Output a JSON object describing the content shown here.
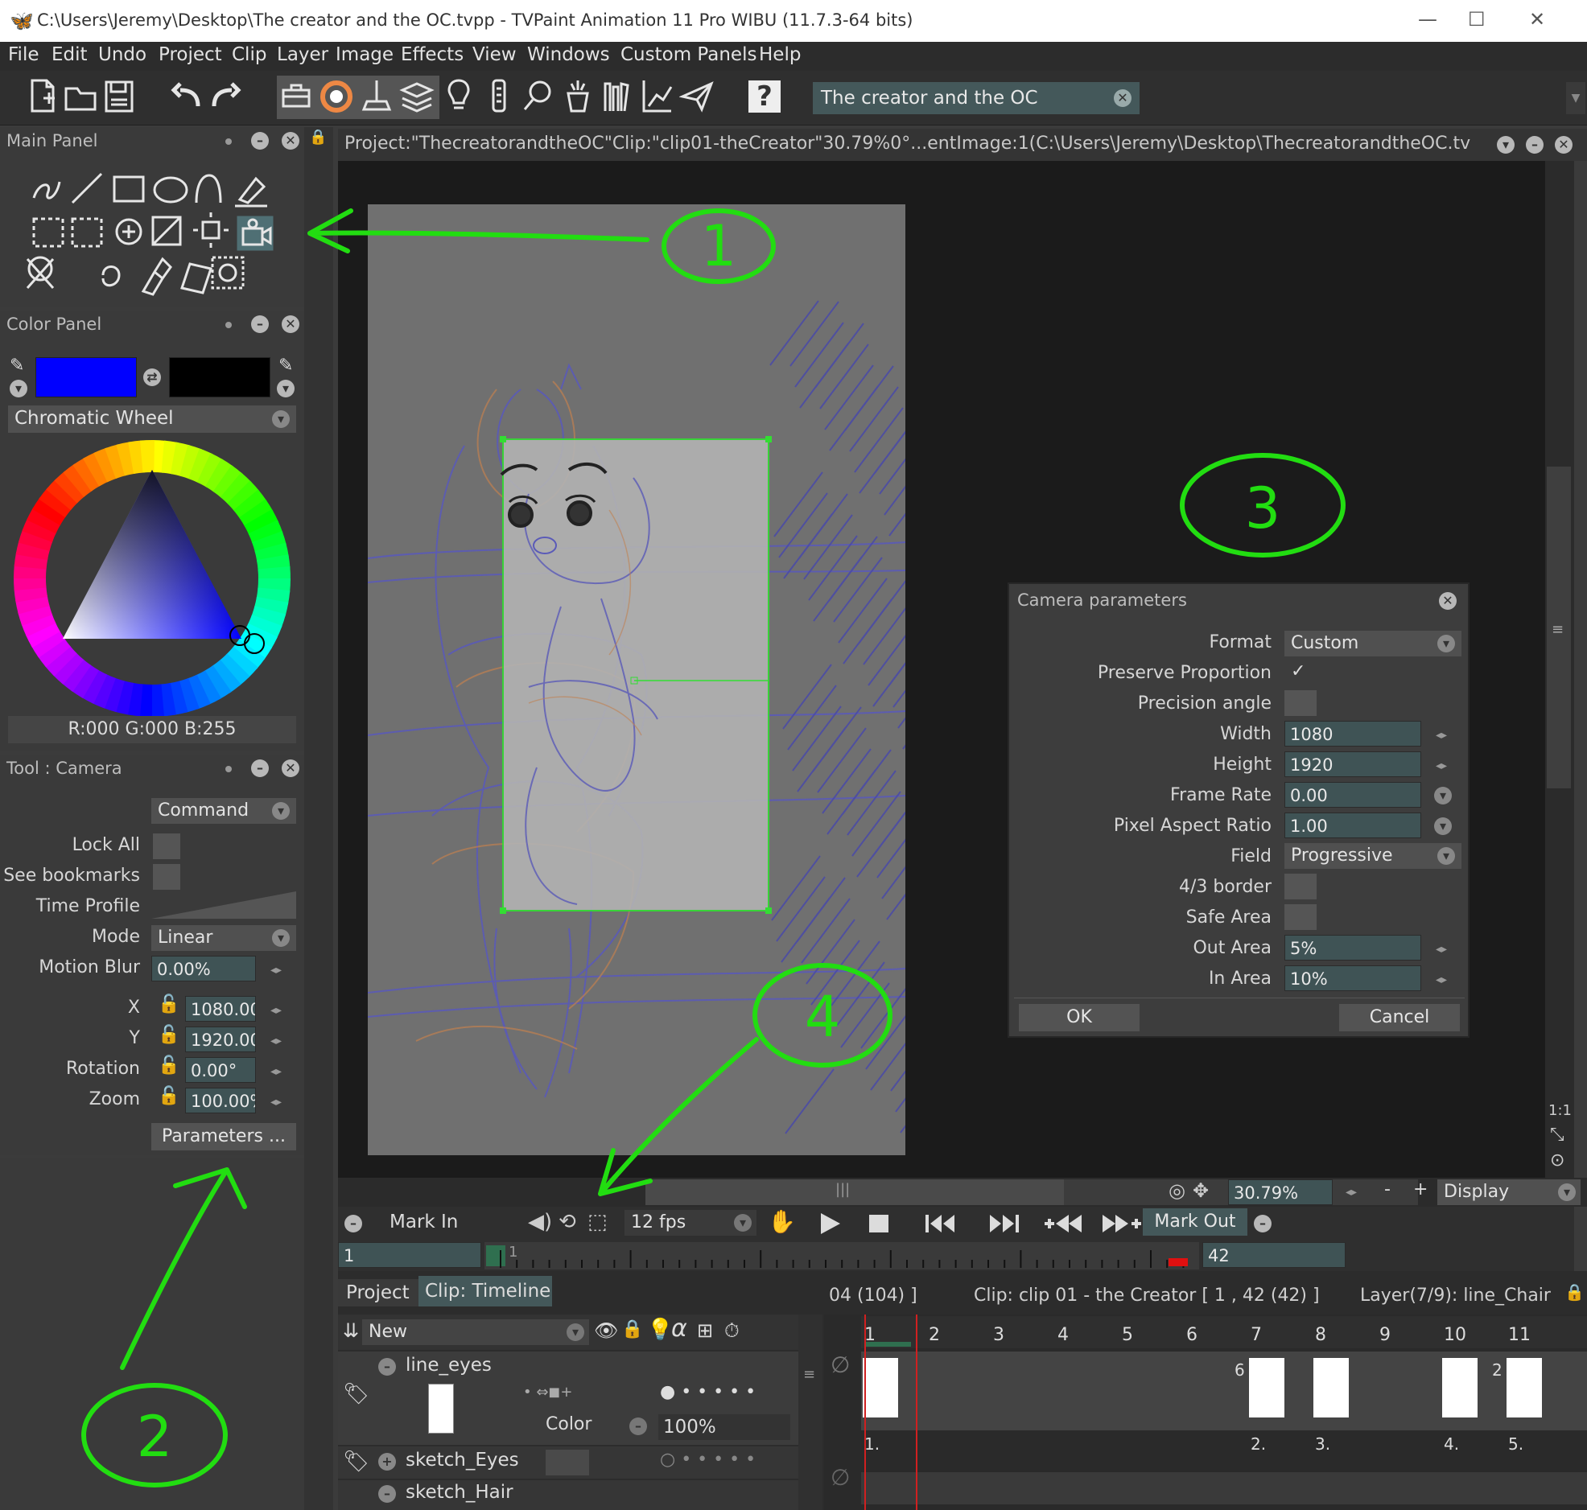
{
  "window": {
    "title": "C:\\Users\\Jeremy\\Desktop\\The creator and the OC.tvpp - TVPaint Animation 11 Pro WIBU (11.7.3-64 bits)",
    "minimize": "—",
    "maximize": "☐",
    "close": "✕"
  },
  "menu": [
    "File",
    "Edit",
    "Undo",
    "Project",
    "Clip",
    "Layer",
    "Image",
    "Effects",
    "View",
    "Windows",
    "Custom Panels",
    "Help"
  ],
  "toolbar": {
    "project_name": "The creator and the OC"
  },
  "main_panel": {
    "title": "Main Panel"
  },
  "color_panel": {
    "title": "Color Panel",
    "mode": "Chromatic Wheel",
    "rgb": "R:000 G:000 B:255",
    "primary_color": "#0000ff",
    "secondary_color": "#000000"
  },
  "tool_panel": {
    "title": "Tool : Camera",
    "command": "Command",
    "lock_all": "Lock All",
    "see_bookmarks": "See bookmarks",
    "time_profile": "Time Profile",
    "mode_label": "Mode",
    "mode_value": "Linear",
    "motion_blur_label": "Motion Blur",
    "motion_blur_value": "0.00%",
    "x_label": "X",
    "x_value": "1080.00",
    "y_label": "Y",
    "y_value": "1920.00",
    "rotation_label": "Rotation",
    "rotation_value": "0.00°",
    "zoom_label": "Zoom",
    "zoom_value": "100.00%",
    "parameters": "Parameters ..."
  },
  "view": {
    "info": "Project:\"ThecreatorandtheOC\"Clip:\"clip01-theCreator\"30.79%0°...entImage:1(C:\\Users\\Jeremy\\Desktop\\ThecreatorandtheOC.tvpp)",
    "zoom": "30.79%",
    "display": "Display",
    "minus": "-",
    "plus": "+"
  },
  "camera_dialog": {
    "title": "Camera parameters",
    "format_label": "Format",
    "format_value": "Custom",
    "preserve_label": "Preserve Proportion",
    "preserve_check": "✓",
    "precision_label": "Precision angle",
    "width_label": "Width",
    "width_value": "1080",
    "height_label": "Height",
    "height_value": "1920",
    "framerate_label": "Frame Rate",
    "framerate_value": "0.00",
    "par_label": "Pixel Aspect Ratio",
    "par_value": "1.00",
    "field_label": "Field",
    "field_value": "Progressive",
    "border_label": "4/3 border",
    "safe_label": "Safe Area",
    "out_label": "Out Area",
    "out_value": "5%",
    "in_label": "In Area",
    "in_value": "10%",
    "ok": "OK",
    "cancel": "Cancel"
  },
  "transport": {
    "mark_in": "Mark In",
    "fps": "12 fps",
    "mark_out": "Mark Out",
    "start_frame": "1",
    "end_frame": "42",
    "cursor_frame": "1"
  },
  "timeline": {
    "tab_project": "Project",
    "tab_clip": "Clip: Timeline",
    "info_left": "04  (104) ]",
    "info_clip": "Clip: clip 01 - the Creator [ 1 , 42  (42) ]",
    "info_layer": "Layer(7/9): line_Chair",
    "new_label": "New",
    "layers": [
      {
        "name": "line_eyes",
        "color_label": "Color",
        "opacity": "100%"
      },
      {
        "name": "sketch_Eyes"
      },
      {
        "name": "sketch_Hair"
      }
    ],
    "frame_numbers": [
      "1",
      "2",
      "3",
      "4",
      "5",
      "6",
      "7",
      "8",
      "9",
      "10",
      "11"
    ],
    "instance_marks": [
      "1.",
      "2.",
      "3.",
      "4.",
      "5."
    ],
    "instance_counts": [
      "6",
      "2"
    ]
  },
  "annotations": [
    "1",
    "2",
    "3",
    "4"
  ],
  "annotation_color": "#22dd11"
}
